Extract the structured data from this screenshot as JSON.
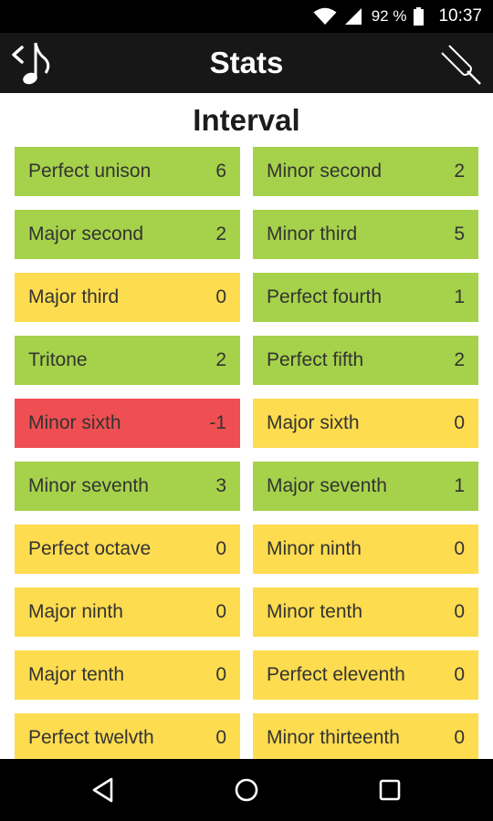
{
  "status_bar": {
    "battery": "92 %",
    "time": "10:37"
  },
  "app_bar": {
    "title": "Stats"
  },
  "section": {
    "title": "Interval"
  },
  "intervals": [
    {
      "label": "Perfect unison",
      "value": "6",
      "status": "good"
    },
    {
      "label": "Minor second",
      "value": "2",
      "status": "good"
    },
    {
      "label": "Major second",
      "value": "2",
      "status": "good"
    },
    {
      "label": "Minor third",
      "value": "5",
      "status": "good"
    },
    {
      "label": "Major third",
      "value": "0",
      "status": "neutral"
    },
    {
      "label": "Perfect fourth",
      "value": "1",
      "status": "good"
    },
    {
      "label": "Tritone",
      "value": "2",
      "status": "good"
    },
    {
      "label": "Perfect fifth",
      "value": "2",
      "status": "good"
    },
    {
      "label": "Minor sixth",
      "value": "-1",
      "status": "bad"
    },
    {
      "label": "Major sixth",
      "value": "0",
      "status": "neutral"
    },
    {
      "label": "Minor seventh",
      "value": "3",
      "status": "good"
    },
    {
      "label": "Major seventh",
      "value": "1",
      "status": "good"
    },
    {
      "label": "Perfect octave",
      "value": "0",
      "status": "neutral"
    },
    {
      "label": "Minor ninth",
      "value": "0",
      "status": "neutral"
    },
    {
      "label": "Major ninth",
      "value": "0",
      "status": "neutral"
    },
    {
      "label": "Minor tenth",
      "value": "0",
      "status": "neutral"
    },
    {
      "label": "Major tenth",
      "value": "0",
      "status": "neutral"
    },
    {
      "label": "Perfect eleventh",
      "value": "0",
      "status": "neutral"
    },
    {
      "label": "Perfect twelvth",
      "value": "0",
      "status": "neutral"
    },
    {
      "label": "Minor thirteenth",
      "value": "0",
      "status": "neutral"
    }
  ],
  "colors": {
    "good": "#a5d24a",
    "neutral": "#fddc4f",
    "bad": "#ef4f52"
  },
  "icons": {
    "back": "music-note-back-icon",
    "settings": "tuning-fork-icon",
    "nav_back": "nav-back-icon",
    "nav_home": "nav-home-icon",
    "nav_recents": "nav-recents-icon"
  }
}
